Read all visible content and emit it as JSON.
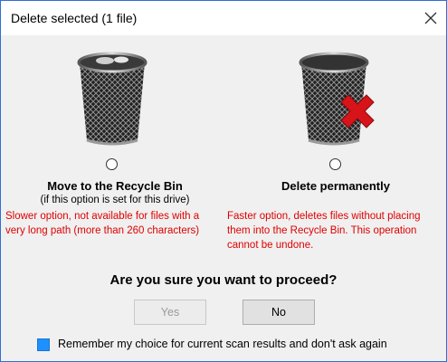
{
  "dialog": {
    "title": "Delete selected (1 file)"
  },
  "options": {
    "recycle": {
      "title": "Move to the Recycle Bin",
      "subtitle": "(if this option is set for this drive)",
      "note_line1": "Slower option, not available for files with a",
      "note_line2": "very long path (more than 260 characters)",
      "selected": false
    },
    "permanent": {
      "title": "Delete permanently",
      "note_line1": "Faster option, deletes files without placing",
      "note_line2": "them into the Recycle Bin. This operation",
      "note_line3": "cannot be undone.",
      "selected": false
    }
  },
  "question": "Are you sure you want to proceed?",
  "buttons": {
    "yes_label": "Yes",
    "yes_enabled": false,
    "no_label": "No"
  },
  "remember": {
    "label": "Remember my choice for current scan results and don't ask again",
    "checked": true
  },
  "colors": {
    "warning_text": "#e00000",
    "accent_checkbox": "#1e90ff",
    "window_border": "#2f6fd6",
    "content_bg": "#f0f0f0",
    "delete_mark": "#d7141a"
  },
  "icons": {
    "close": "close-icon",
    "recycle_bin": "recycle-bin-icon",
    "delete_mark": "red-x-icon"
  }
}
